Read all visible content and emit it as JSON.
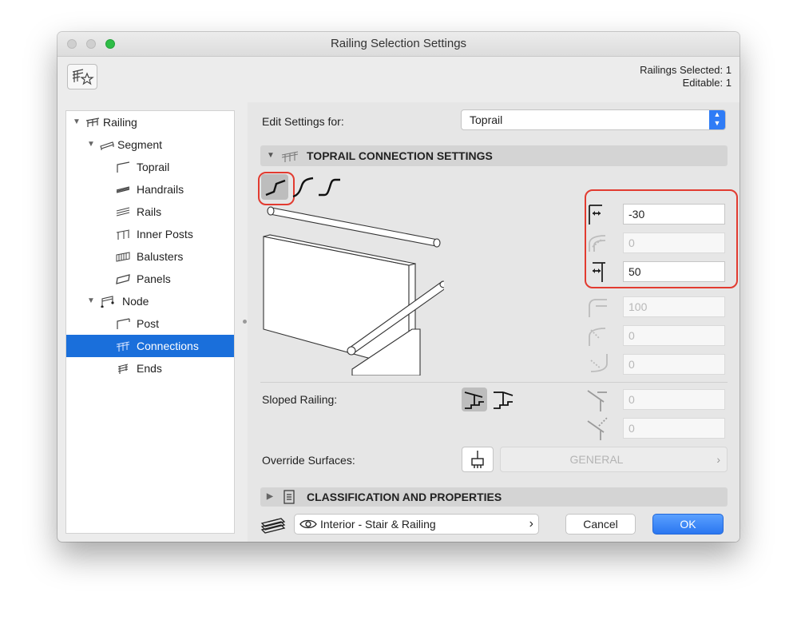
{
  "window": {
    "title": "Railing Selection Settings",
    "traffic_colors": [
      "#cfcfcf",
      "#cfcfcf",
      "#2ebd46"
    ]
  },
  "selection_info": {
    "line1": "Railings Selected: 1",
    "line2": "Editable: 1"
  },
  "tree": {
    "items": [
      {
        "label": "Railing",
        "level": 0,
        "expanded": true,
        "icon": "railing-icon"
      },
      {
        "label": "Segment",
        "level": 1,
        "expanded": true,
        "icon": "segment-icon"
      },
      {
        "label": "Toprail",
        "level": 2,
        "icon": "toprail-icon"
      },
      {
        "label": "Handrails",
        "level": 2,
        "icon": "handrails-icon"
      },
      {
        "label": "Rails",
        "level": 2,
        "icon": "rails-icon"
      },
      {
        "label": "Inner Posts",
        "level": 2,
        "icon": "inner-posts-icon"
      },
      {
        "label": "Balusters",
        "level": 2,
        "icon": "balusters-icon"
      },
      {
        "label": "Panels",
        "level": 2,
        "icon": "panels-icon"
      },
      {
        "label": "Node",
        "level": 1,
        "expanded": true,
        "icon": "node-icon"
      },
      {
        "label": "Post",
        "level": 2,
        "icon": "post-icon"
      },
      {
        "label": "Connections",
        "level": 2,
        "selected": true,
        "icon": "connections-icon"
      },
      {
        "label": "Ends",
        "level": 2,
        "icon": "ends-icon"
      }
    ]
  },
  "edit_settings": {
    "label": "Edit Settings for:",
    "value": "Toprail"
  },
  "section_connection": {
    "title": "TOPRAIL CONNECTION SETTINGS"
  },
  "fields": {
    "f1": "-30",
    "f2": "0",
    "f3": "50",
    "f4": "100",
    "f5": "0",
    "f6": "0",
    "f7": "0",
    "f8": "0"
  },
  "sloped_railing": {
    "label": "Sloped Railing:"
  },
  "override_surfaces": {
    "label": "Override Surfaces:",
    "value": "GENERAL"
  },
  "section_classification": {
    "title": "CLASSIFICATION AND PROPERTIES"
  },
  "footer": {
    "layer": "Interior - Stair & Railing",
    "cancel": "Cancel",
    "ok": "OK"
  },
  "colors": {
    "accent": "#1a6fdb",
    "ok_button": "#2a76f0",
    "highlight_red": "#e23b30"
  }
}
